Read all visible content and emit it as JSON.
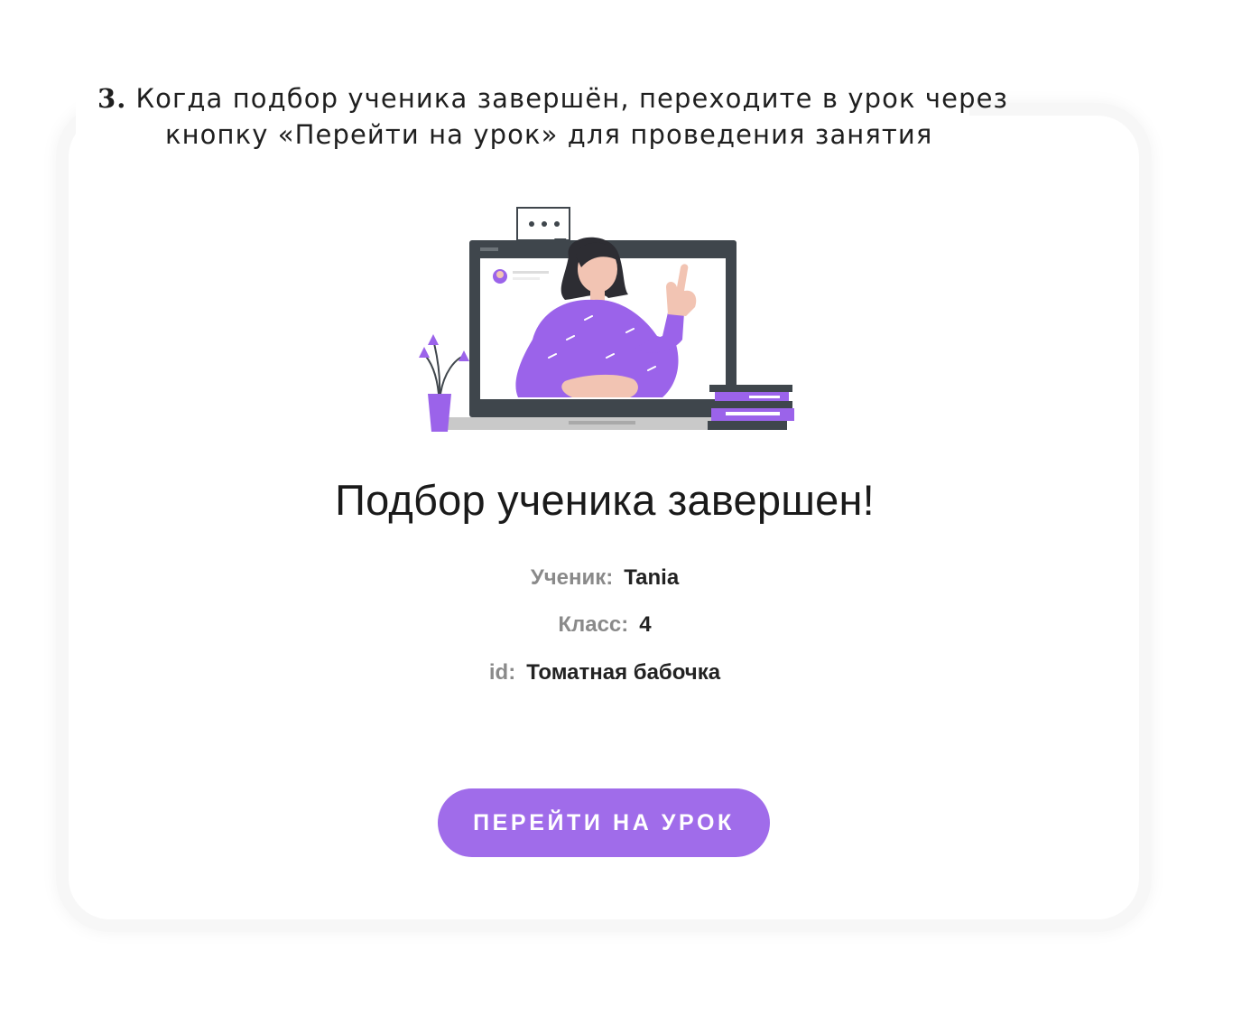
{
  "instruction": {
    "step_number": "3.",
    "line1": "Когда подбор ученика завершён, переходите в урок через",
    "line2": "кнопку «Перейти на урок» для проведения занятия"
  },
  "card": {
    "title": "Подбор ученика завершен!",
    "student": {
      "label": "Ученик:",
      "value": "Tania"
    },
    "grade": {
      "label": "Класс:",
      "value": "4"
    },
    "id": {
      "label": "id:",
      "value": "Томатная бабочка"
    },
    "button_label": "ПЕРЕЙТИ НА УРОК"
  },
  "colors": {
    "accent": "#a06cea",
    "illustration_purple": "#9b63ea",
    "monitor_dark": "#3f464c",
    "skin": "#f2c4b3"
  },
  "icons": [
    "teacher-on-screen-illustration",
    "chat-bubble-icon",
    "plant-icon",
    "books-icon",
    "avatar-icon"
  ]
}
